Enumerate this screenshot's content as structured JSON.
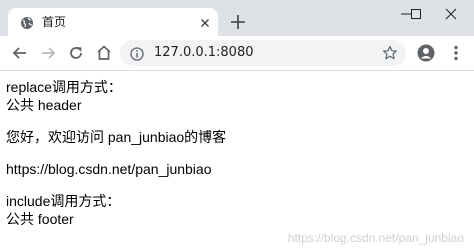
{
  "browser": {
    "tab_title": "首页",
    "url": "127.0.0.1:8080"
  },
  "page": {
    "replace_heading": "replace调用方式：",
    "header_text": "公共 header",
    "greeting": "您好，欢迎访问 pan_junbiao的博客",
    "blog_url": "https://blog.csdn.net/pan_junbiao",
    "include_heading": "include调用方式：",
    "footer_text": "公共 footer"
  },
  "watermark": "https://blog.csdn.net/pan_junbiao",
  "colors": {
    "titlebar": "#dee1e6",
    "omnibox": "#f1f3f4",
    "text": "#000000",
    "icon": "#5f6368"
  }
}
